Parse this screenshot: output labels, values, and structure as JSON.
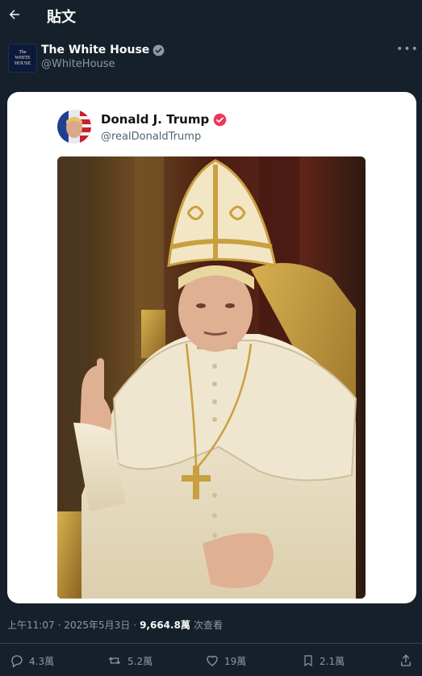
{
  "header": {
    "title": "貼文"
  },
  "author": {
    "name": "The White House",
    "handle": "@WhiteHouse",
    "avatar_text_1": "The",
    "avatar_text_2": "WHITE",
    "avatar_text_3": "HOUSE"
  },
  "embedded_post": {
    "name": "Donald J. Trump",
    "handle": "@realDonaldTrump"
  },
  "meta": {
    "time": "上午11:07",
    "date": "2025年5月3日",
    "views_count": "9,664.8萬",
    "views_label": "次查看"
  },
  "actions": {
    "replies": "4.3萬",
    "reposts": "5.2萬",
    "likes": "19萬",
    "bookmarks": "2.1萬"
  },
  "colors": {
    "background": "#15202b",
    "verified_blue": "#8b98a5",
    "verified_red": "#f0355b",
    "muted": "#8b98a5"
  }
}
